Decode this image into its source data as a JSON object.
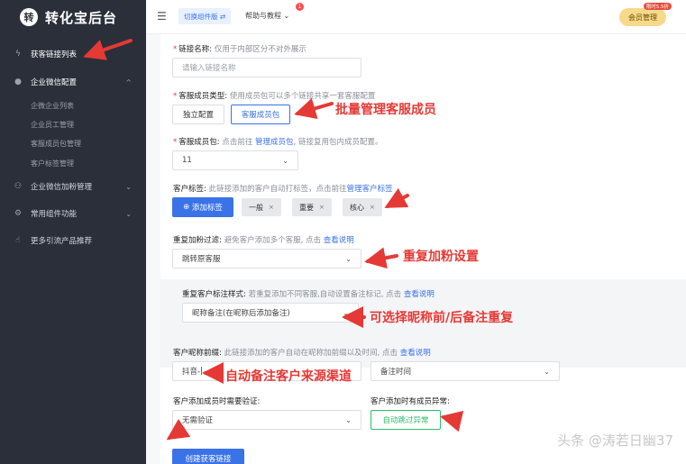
{
  "brand": {
    "logo_char": "转",
    "title": "转化宝后台"
  },
  "sidebar": {
    "items": [
      {
        "label": "获客链接列表",
        "icon": "bolt-icon"
      },
      {
        "label": "企业微信配置",
        "icon": "wechat-icon"
      },
      {
        "label": "企业微信加粉管理",
        "icon": "users-icon"
      },
      {
        "label": "常用组件功能",
        "icon": "settings-icon"
      },
      {
        "label": "更多引流产品推荐",
        "icon": "thumbs-up-icon"
      }
    ],
    "sub_items": [
      "企微企业列表",
      "企业员工管理",
      "客服成员包管理",
      "客户标签管理"
    ]
  },
  "header": {
    "switch_label": "切换组件版 ⇄",
    "help_label": "帮助与教程",
    "help_badge": "1",
    "vip_label": "会员管理",
    "vip_tag": "限时5.5折"
  },
  "form": {
    "link_name": {
      "label": "链接名称:",
      "hint": "仅用于内部区分不对外展示",
      "placeholder": "请输入链接名称"
    },
    "member_type": {
      "label": "客服成员类型:",
      "hint": "使用成员包可以多个链接共享一套客服配置",
      "options": [
        "独立配置",
        "客服成员包"
      ]
    },
    "member_pkg": {
      "label": "客服成员包:",
      "hint_pre": "点击前往",
      "hint_link": "管理成员包",
      "hint_post": ", 链接复用包内成员配置。",
      "value": "11"
    },
    "customer_tags": {
      "label": "客户标签:",
      "hint_pre": "此链接添加的客户自动打标签，点击前往",
      "hint_link": "管理客户标签",
      "add_button": "添加标签",
      "tags": [
        "一般",
        "重要",
        "核心"
      ]
    },
    "dup_filter": {
      "label": "重复加粉过滤:",
      "hint_pre": "避免客户添加多个客服, 点击",
      "hint_link": "查看说明",
      "value": "跳转原客服"
    },
    "dup_style": {
      "label": "重复客户标注样式:",
      "hint_pre": "若重复添加不同客服,自动设置备注标记, 点击",
      "hint_link": "查看说明",
      "value": "昵称备注(在昵称后添加备注)"
    },
    "nick_prefix": {
      "label": "客户昵称前缀:",
      "hint_pre": "此链接添加的客户自动在昵称加前缀以及时间, 点击",
      "hint_link": "查看说明",
      "prefix_value": "抖音-",
      "time_value": "备注时间"
    },
    "verify": {
      "label": "客户添加成员时需要验证:",
      "value": "无需验证"
    },
    "abnormal": {
      "label": "客户添加时有成员异常:",
      "value": "自动跳过异常"
    },
    "submit": "创建获客链接"
  },
  "annotations": {
    "a1": "批量管理客服成员",
    "a2": "重复加粉设置",
    "a3": "可选择昵称前/后备注重复",
    "a4": "自动备注客户来源渠道"
  },
  "watermark": "头条 @涛若日幽37",
  "colors": {
    "sidebar_bg": "#2b2f3a",
    "primary": "#3a72e8",
    "annotation": "#e53935",
    "success": "#2ebd6b"
  }
}
